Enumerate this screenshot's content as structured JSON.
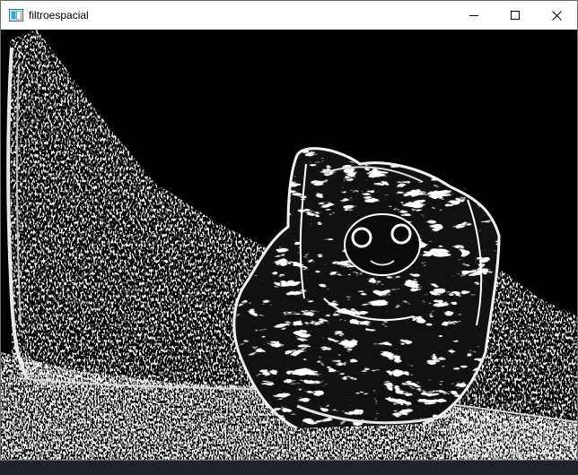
{
  "window": {
    "title": "filtroespacial",
    "app_icon": "window-app-icon",
    "controls": {
      "minimize_icon": "minimize-icon",
      "maximize_icon": "maximize-icon",
      "close_icon": "close-icon"
    }
  },
  "canvas": {
    "image": "edge-filtered-figurine-image"
  }
}
